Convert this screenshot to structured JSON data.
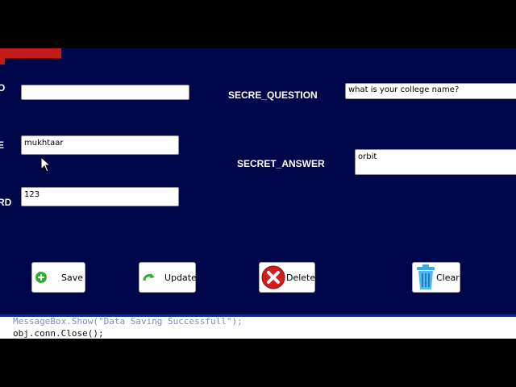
{
  "form": {
    "left_labels": [
      "O",
      "E",
      "RD"
    ],
    "secret_question_label": "SECRE_QUESTION",
    "secret_answer_label": "SECRET_ANSWER",
    "field_top_value": "",
    "username_value": "mukhtaar",
    "password_value": "123",
    "secret_question_value": "what is your college name?",
    "secret_answer_value": "orbit"
  },
  "buttons": {
    "save": "Save",
    "update": "Update",
    "delete": "Delete",
    "clear": "Clear"
  },
  "code": {
    "line_partial": "MessageBox.Show(\"Data Saving Successfull\");",
    "line_main": "obj.conn.Close();"
  },
  "colors": {
    "form_background": "#010549",
    "save_icon": "#2fae2f",
    "delete_icon": "#d21d1d",
    "clear_icon": "#3aa8e6"
  }
}
